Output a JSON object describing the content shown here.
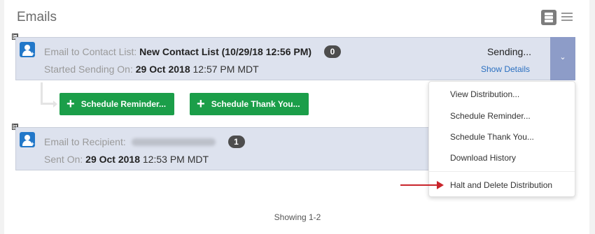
{
  "header": {
    "title": "Emails",
    "view_toggle": [
      "card-view-icon",
      "list-view-icon"
    ]
  },
  "rows": [
    {
      "toggle": "⊟",
      "icon": "contact-add-icon",
      "label": "Email to Contact List:",
      "target": "New Contact List (10/29/18 12:56 PM)",
      "count": "0",
      "sub_label": "Started Sending On:",
      "sub_date": "29 Oct 2018",
      "sub_time": "12:57 PM MDT",
      "status": "Sending...",
      "details_link": "Show Details"
    },
    {
      "toggle": "⊞",
      "icon": "contact-add-icon",
      "label": "Email to Recipient:",
      "target": "Lola Shakespeare",
      "count": "1",
      "sub_label": "Sent On:",
      "sub_date": "29 Oct 2018",
      "sub_time": "12:53 PM MDT"
    }
  ],
  "actions": {
    "schedule_reminder": "Schedule Reminder...",
    "schedule_thank_you": "Schedule Thank You..."
  },
  "menu": {
    "items": [
      "View Distribution...",
      "Schedule Reminder...",
      "Schedule Thank You...",
      "Download History",
      "Halt and Delete Distribution"
    ]
  },
  "footer": {
    "showing": "Showing 1-2"
  },
  "colors": {
    "accent": "#2a6fc0",
    "green": "#1b9e49",
    "annotation_arrow": "#c9252b",
    "row_bg": "#dde2ee"
  }
}
